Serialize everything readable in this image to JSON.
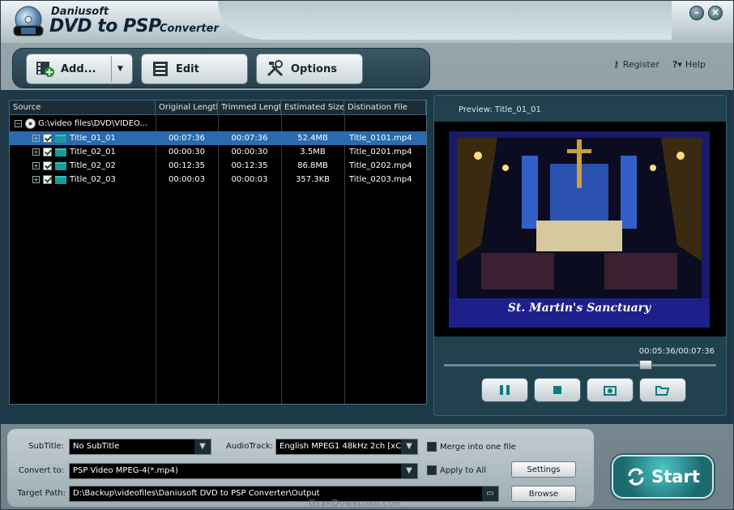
{
  "app": {
    "brand": "Daniusoft",
    "product": "DVD to PSP",
    "product_sub": "Converter"
  },
  "toolbar": {
    "add_label": "Add...",
    "add_dropdown_icon": "triangle-down",
    "edit_label": "Edit",
    "options_label": "Options"
  },
  "header_links": {
    "register_label": "Register",
    "help_label": "Help"
  },
  "file_list": {
    "columns": [
      "Source",
      "Original Length",
      "Trimmed Length",
      "Estimated Size",
      "Distination File"
    ],
    "source_path": "G:\\video files\\DVD\\VIDEO...",
    "rows": [
      {
        "title": "Title_01_01",
        "original": "00:07:36",
        "trimmed": "00:07:36",
        "size": "52.4MB",
        "dest": "Title_0101.mp4",
        "selected": true
      },
      {
        "title": "Title_02_01",
        "original": "00:00:30",
        "trimmed": "00:00:30",
        "size": "3.5MB",
        "dest": "Title_0201.mp4",
        "selected": false
      },
      {
        "title": "Title_02_02",
        "original": "00:12:35",
        "trimmed": "00:12:35",
        "size": "86.8MB",
        "dest": "Title_0202.mp4",
        "selected": false
      },
      {
        "title": "Title_02_03",
        "original": "00:00:03",
        "trimmed": "00:00:03",
        "size": "357.3KB",
        "dest": "Title_0203.mp4",
        "selected": false
      }
    ]
  },
  "preview": {
    "label": "Preview: Title_01_01",
    "caption": "St. Martin's Sanctuary",
    "time": "00:05:36/00:07:36",
    "progress_fraction": 0.74
  },
  "settings": {
    "subtitle_label": "SubTitle:",
    "subtitle_value": "No SubTitle",
    "audiotrack_label": "AudioTrack:",
    "audiotrack_value": "English MPEG1 48kHz 2ch [xC0]",
    "merge_label": "Merge into one file",
    "convert_label": "Convert to:",
    "convert_value": "PSP Video MPEG-4(*.mp4)",
    "apply_all_label": "Apply to All",
    "settings_button": "Settings",
    "target_label": "Target Path:",
    "target_value": "D:\\Backup\\videofiles\\Daniusoft DVD to PSP Converter\\Output",
    "browse_button": "Browse"
  },
  "start_label": "Start",
  "watermark": "GearDownload.com",
  "colors": {
    "selection": "#2a6bb0",
    "panel": "#1c3947",
    "accent": "#1f9a9a"
  }
}
